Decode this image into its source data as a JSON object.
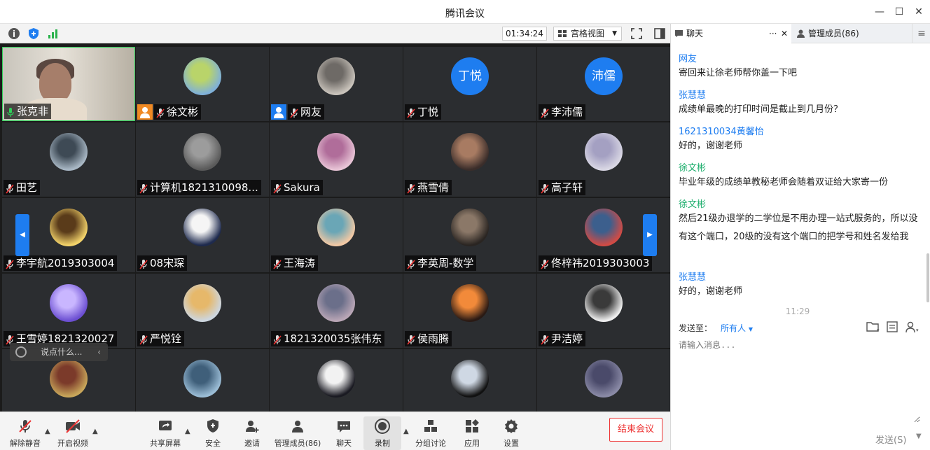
{
  "window": {
    "title": "腾讯会议"
  },
  "toolbar": {
    "timer": "01:34:24",
    "view_mode": "宫格视图"
  },
  "participants": [
    {
      "name": "张克非",
      "kind": "camera"
    },
    {
      "name": "徐文彬",
      "kind": "photo",
      "badge": "orange"
    },
    {
      "name": "网友",
      "kind": "photo",
      "badge": "blue"
    },
    {
      "name": "丁悦",
      "kind": "text",
      "initials": "丁悦"
    },
    {
      "name": "李沛儒",
      "kind": "text",
      "initials": "沛儒"
    },
    {
      "name": "田艺",
      "kind": "photo"
    },
    {
      "name": "计算机1821310098...",
      "kind": "photo"
    },
    {
      "name": "Sakura",
      "kind": "photo"
    },
    {
      "name": "燕雪倩",
      "kind": "photo"
    },
    {
      "name": "高子轩",
      "kind": "photo"
    },
    {
      "name": "李宇航2019303004",
      "kind": "photo"
    },
    {
      "name": "08宋琛",
      "kind": "photo"
    },
    {
      "name": "王海涛",
      "kind": "photo"
    },
    {
      "name": "李英周-数学",
      "kind": "photo"
    },
    {
      "name": "佟梓祎2019303003",
      "kind": "photo"
    },
    {
      "name": "王雪婷1821320027",
      "kind": "photo"
    },
    {
      "name": "严悦铨",
      "kind": "photo"
    },
    {
      "name": "1821320035张伟东",
      "kind": "photo"
    },
    {
      "name": "侯雨腾",
      "kind": "photo"
    },
    {
      "name": "尹洁婷",
      "kind": "photo"
    },
    {
      "name": "",
      "kind": "photo"
    },
    {
      "name": "",
      "kind": "photo"
    },
    {
      "name": "",
      "kind": "photo"
    },
    {
      "name": "",
      "kind": "photo"
    },
    {
      "name": "",
      "kind": "photo"
    }
  ],
  "grid_overlay": {
    "chat_hint": "说点什么..."
  },
  "bottom_bar": {
    "mute": "解除静音",
    "video": "开启视频",
    "share": "共享屏幕",
    "security": "安全",
    "invite": "邀请",
    "manage": "管理成员(86)",
    "chat": "聊天",
    "record": "录制",
    "breakout": "分组讨论",
    "apps": "应用",
    "settings": "设置",
    "end": "结束会议"
  },
  "panel": {
    "tab_chat": "聊天",
    "tab_members": "管理成员(86)",
    "messages": [
      {
        "sender": "网友",
        "color": "blue",
        "text": "寄回来让徐老师帮你盖一下吧"
      },
      {
        "sender": "张慧慧",
        "color": "blue",
        "text": "成绩单最晚的打印时间是截止到几月份？"
      },
      {
        "sender": "1621310034黄馨怡",
        "color": "blue",
        "text": "好的，谢谢老师"
      },
      {
        "sender": "徐文彬",
        "color": "green",
        "text": "毕业年级的成绩单教秘老师会随着双证给大家寄一份"
      },
      {
        "sender": "徐文彬",
        "color": "green",
        "text": "然后21级办退学的二学位是不用办理一站式服务的，所以没有这个端口，20级的没有这个端口的把学号和姓名发给我"
      },
      {
        "sender": "张慧慧",
        "color": "blue",
        "text": "好的，谢谢老师"
      }
    ],
    "timestamp": "11:29",
    "send_to_label": "发送至：",
    "send_to_value": "所有人",
    "input_placeholder": "请输入消息...",
    "send_label": "发送(S)"
  },
  "colors": {
    "accent": "#1e7df0",
    "end_red": "#e33333",
    "active_speaker": "#2fd05a",
    "host_green": "#1aad6b"
  }
}
